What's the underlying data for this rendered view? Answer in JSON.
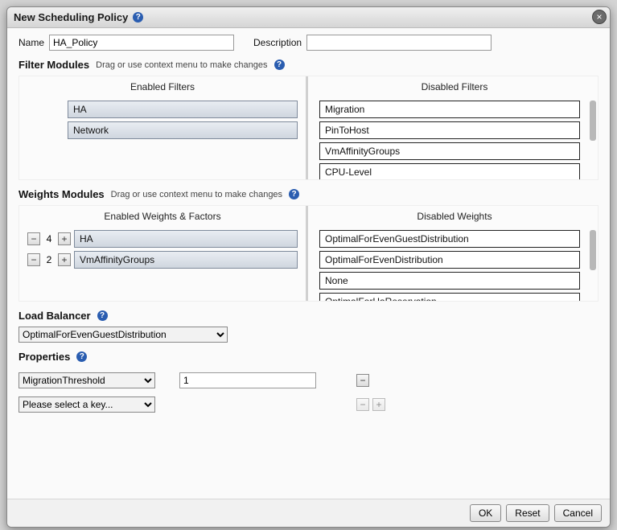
{
  "dialog": {
    "title": "New Scheduling Policy"
  },
  "form": {
    "name_label": "Name",
    "name_value": "HA_Policy",
    "description_label": "Description",
    "description_value": ""
  },
  "filters": {
    "section_title": "Filter Modules",
    "section_hint": "Drag or use context menu to make changes",
    "enabled_title": "Enabled Filters",
    "disabled_title": "Disabled Filters",
    "enabled": [
      "HA",
      "Network"
    ],
    "disabled": [
      "Migration",
      "PinToHost",
      "VmAffinityGroups",
      "CPU-Level"
    ]
  },
  "weights": {
    "section_title": "Weights Modules",
    "section_hint": "Drag or use context menu to make changes",
    "enabled_title": "Enabled Weights & Factors",
    "disabled_title": "Disabled Weights",
    "enabled": [
      {
        "factor": 4,
        "name": "HA"
      },
      {
        "factor": 2,
        "name": "VmAffinityGroups"
      }
    ],
    "disabled": [
      "OptimalForEvenGuestDistribution",
      "OptimalForEvenDistribution",
      "None",
      "OptimalForHaReservation"
    ]
  },
  "load_balancer": {
    "section_title": "Load Balancer",
    "selected": "OptimalForEvenGuestDistribution"
  },
  "properties": {
    "section_title": "Properties",
    "rows": [
      {
        "key_selected": "MigrationThreshold",
        "value": "1",
        "minus_enabled": true,
        "plus_enabled": false
      },
      {
        "key_selected": "Please select a key...",
        "value": null,
        "minus_enabled": false,
        "plus_enabled": false
      }
    ]
  },
  "buttons": {
    "ok": "OK",
    "reset": "Reset",
    "cancel": "Cancel"
  }
}
